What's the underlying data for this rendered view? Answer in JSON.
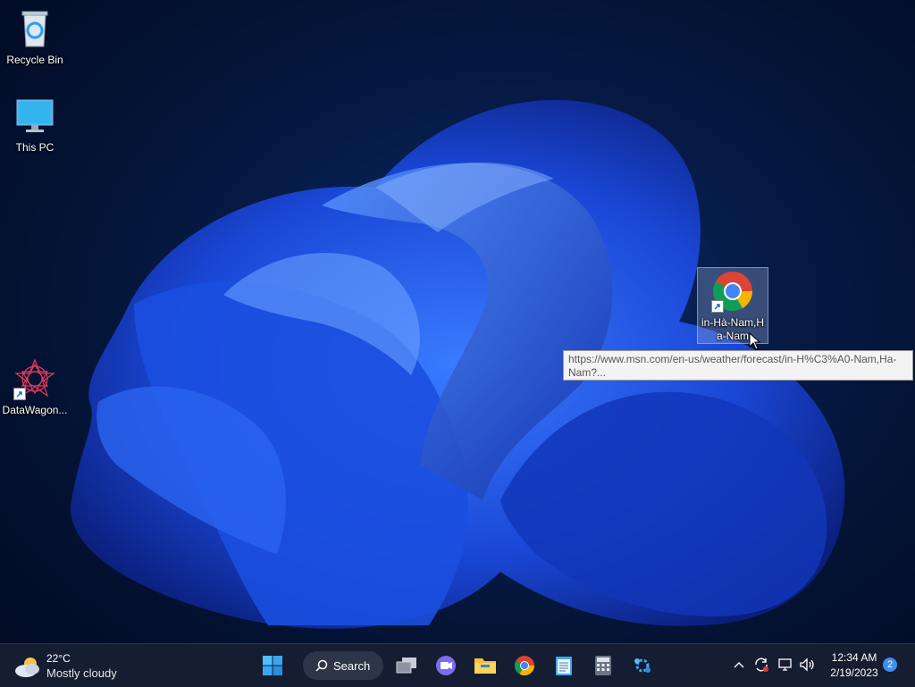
{
  "desktop": {
    "icons": [
      {
        "label": "Recycle Bin"
      },
      {
        "label": "This PC"
      },
      {
        "label": "DataWagon..."
      },
      {
        "label": "in-Hà-Nam,Ha-Nam"
      }
    ],
    "tooltip": "https://www.msn.com/en-us/weather/forecast/in-H%C3%A0-Nam,Ha-Nam?..."
  },
  "taskbar": {
    "weather_temp": "22°C",
    "weather_condition": "Mostly cloudy",
    "search_label": "Search",
    "time": "12:34 AM",
    "date": "2/19/2023",
    "notification_count": "2"
  },
  "colors": {
    "accent": "#1e5bff",
    "taskbar": "#161e32"
  }
}
